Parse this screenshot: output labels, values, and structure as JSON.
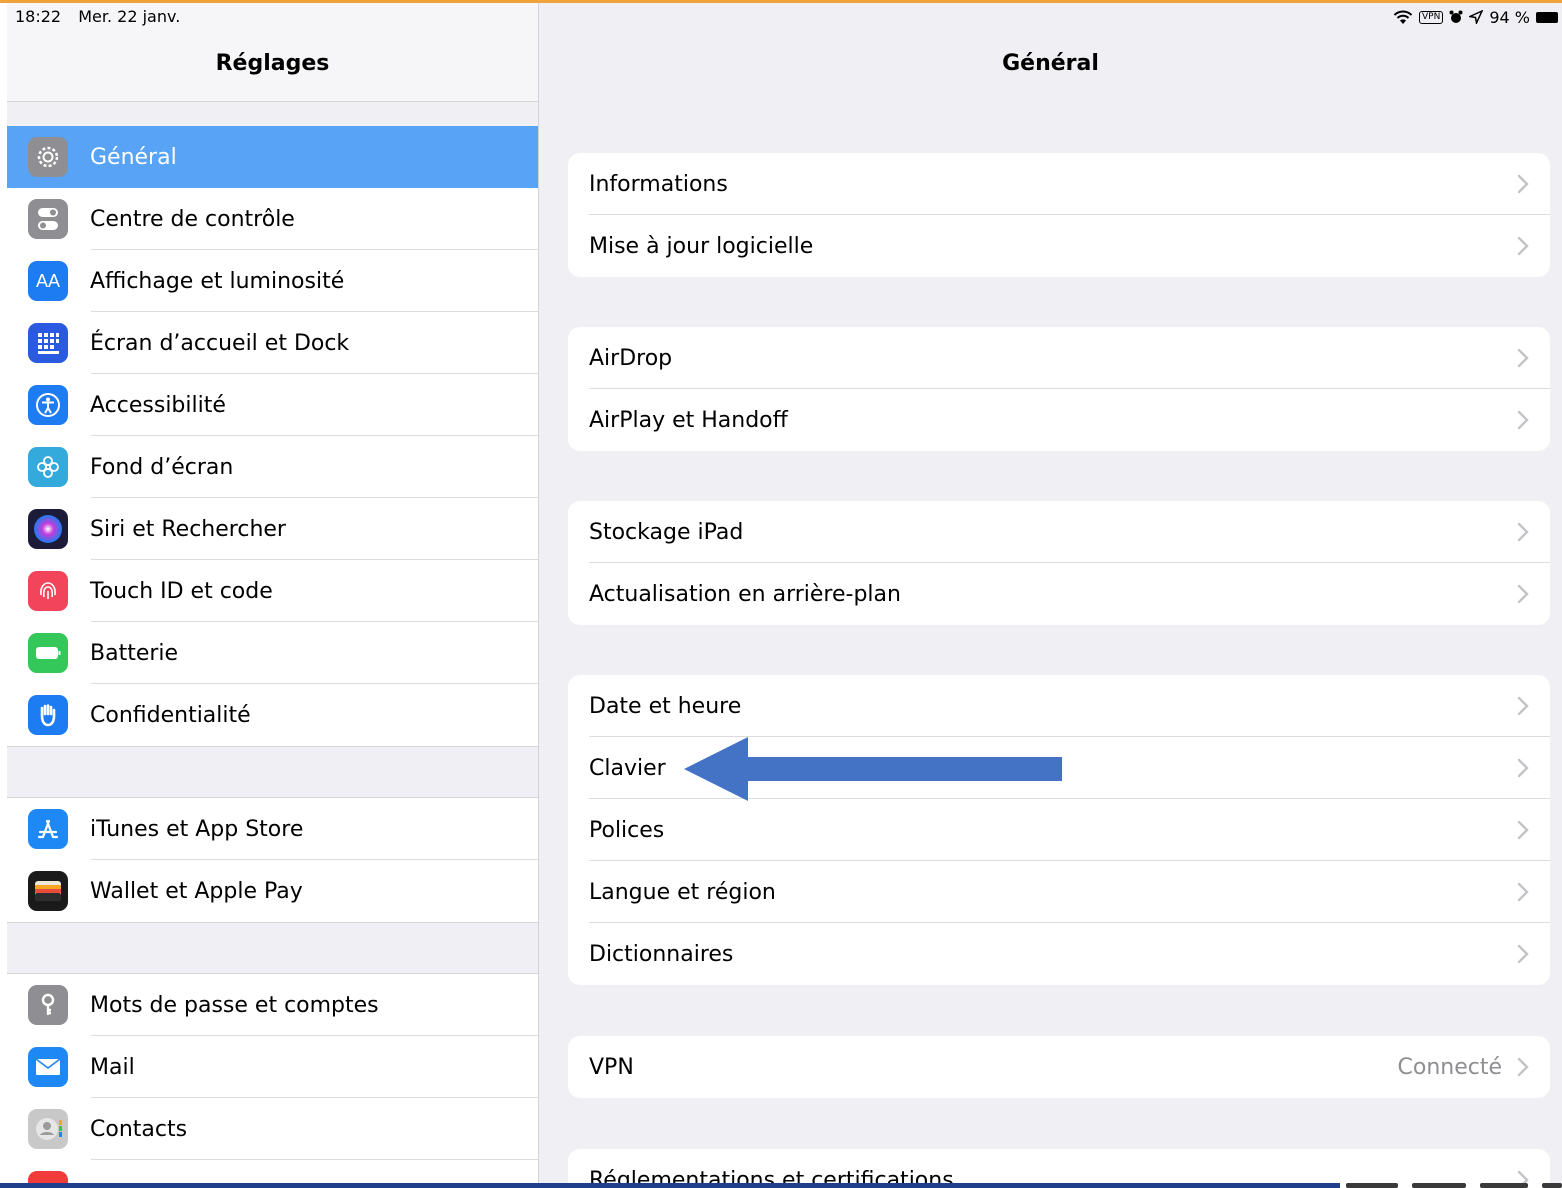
{
  "status_bar": {
    "time": "18:22",
    "date": "Mer. 22 janv.",
    "vpn": "VPN",
    "battery": "94 %"
  },
  "sidebar": {
    "title": "Réglages",
    "groups": [
      [
        {
          "label": "Général",
          "icon": "gear-icon",
          "color": "#8e8e93",
          "selected": true
        },
        {
          "label": "Centre de contrôle",
          "icon": "toggles-icon",
          "color": "#8e8e93"
        },
        {
          "label": "Affichage et luminosité",
          "icon": "text-size-icon",
          "color": "#1e7cf2"
        },
        {
          "label": "Écran d’accueil et Dock",
          "icon": "home-grid-icon",
          "color": "#2b5ae0"
        },
        {
          "label": "Accessibilité",
          "icon": "accessibility-icon",
          "color": "#1e7cf2"
        },
        {
          "label": "Fond d’écran",
          "icon": "flower-icon",
          "color": "#34aadc"
        },
        {
          "label": "Siri et Rechercher",
          "icon": "siri-icon",
          "color": "#1c1c3a"
        },
        {
          "label": "Touch ID et code",
          "icon": "fingerprint-icon",
          "color": "#f2455b"
        },
        {
          "label": "Batterie",
          "icon": "battery-icon",
          "color": "#34c759"
        },
        {
          "label": "Confidentialité",
          "icon": "hand-icon",
          "color": "#1e7cf2"
        }
      ],
      [
        {
          "label": "iTunes et App Store",
          "icon": "app-store-icon",
          "color": "#1e88f5"
        },
        {
          "label": "Wallet et Apple Pay",
          "icon": "wallet-icon",
          "color": "#1a1a1a"
        }
      ],
      [
        {
          "label": "Mots de passe et comptes",
          "icon": "key-icon",
          "color": "#8e8e93"
        },
        {
          "label": "Mail",
          "icon": "mail-icon",
          "color": "#1e88f5"
        },
        {
          "label": "Contacts",
          "icon": "contacts-icon",
          "color": "#c8c8c8"
        },
        {
          "label": "",
          "icon": "calendar-icon",
          "color": "#f23b3b"
        }
      ]
    ]
  },
  "main": {
    "title": "Général",
    "cards": [
      [
        {
          "label": "Informations"
        },
        {
          "label": "Mise à jour logicielle"
        }
      ],
      [
        {
          "label": "AirDrop"
        },
        {
          "label": "AirPlay et Handoff"
        }
      ],
      [
        {
          "label": "Stockage iPad"
        },
        {
          "label": "Actualisation en arrière-plan"
        }
      ],
      [
        {
          "label": "Date et heure"
        },
        {
          "label": "Clavier"
        },
        {
          "label": "Polices"
        },
        {
          "label": "Langue et région"
        },
        {
          "label": "Dictionnaires"
        }
      ],
      [
        {
          "label": "VPN",
          "value": "Connecté"
        }
      ],
      [
        {
          "label": "Réglementations et certifications"
        }
      ]
    ]
  },
  "annotation": {
    "arrow_color": "#4472c4"
  }
}
